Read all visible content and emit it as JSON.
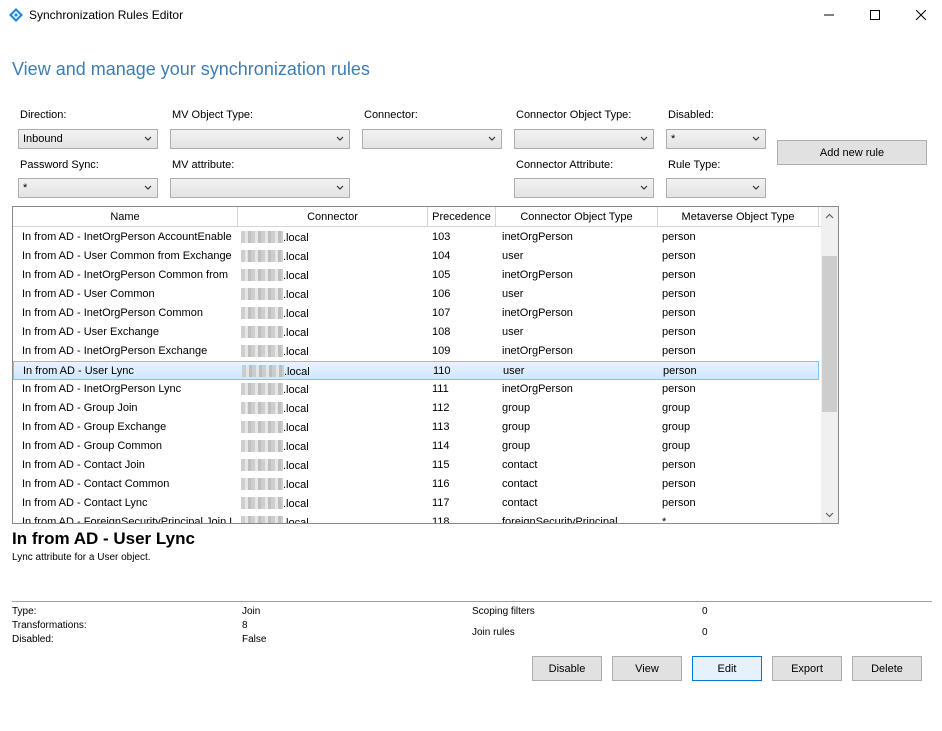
{
  "window": {
    "title": "Synchronization Rules Editor"
  },
  "heading": "View and manage your synchronization rules",
  "filters": {
    "direction": {
      "label": "Direction:",
      "value": "Inbound"
    },
    "mv_object_type": {
      "label": "MV Object Type:",
      "value": ""
    },
    "connector": {
      "label": "Connector:",
      "value": ""
    },
    "connector_object_type": {
      "label": "Connector Object Type:",
      "value": ""
    },
    "disabled": {
      "label": "Disabled:",
      "value": "*"
    },
    "password_sync": {
      "label": "Password Sync:",
      "value": "*"
    },
    "mv_attribute": {
      "label": "MV attribute:",
      "value": ""
    },
    "connector_attribute": {
      "label": "Connector Attribute:",
      "value": ""
    },
    "rule_type": {
      "label": "Rule Type:",
      "value": ""
    }
  },
  "add_rule_label": "Add new rule",
  "table": {
    "columns": [
      "Name",
      "Connector",
      "Precedence",
      "Connector Object Type",
      "Metaverse Object Type"
    ],
    "rows": [
      {
        "name": "In from AD - InetOrgPerson AccountEnabled",
        "connector": ".local",
        "precedence": "103",
        "cot": "inetOrgPerson",
        "mot": "person"
      },
      {
        "name": "In from AD - User Common from Exchange",
        "connector": ".local",
        "precedence": "104",
        "cot": "user",
        "mot": "person"
      },
      {
        "name": "In from AD - InetOrgPerson Common from Exchange",
        "connector": ".local",
        "precedence": "105",
        "cot": "inetOrgPerson",
        "mot": "person"
      },
      {
        "name": "In from AD - User Common",
        "connector": ".local",
        "precedence": "106",
        "cot": "user",
        "mot": "person"
      },
      {
        "name": "In from AD - InetOrgPerson Common",
        "connector": ".local",
        "precedence": "107",
        "cot": "inetOrgPerson",
        "mot": "person"
      },
      {
        "name": "In from AD - User Exchange",
        "connector": ".local",
        "precedence": "108",
        "cot": "user",
        "mot": "person"
      },
      {
        "name": "In from AD - InetOrgPerson Exchange",
        "connector": ".local",
        "precedence": "109",
        "cot": "inetOrgPerson",
        "mot": "person"
      },
      {
        "name": "In from AD - User Lync",
        "connector": ".local",
        "precedence": "110",
        "cot": "user",
        "mot": "person"
      },
      {
        "name": "In from AD - InetOrgPerson Lync",
        "connector": ".local",
        "precedence": "111",
        "cot": "inetOrgPerson",
        "mot": "person"
      },
      {
        "name": "In from AD - Group Join",
        "connector": ".local",
        "precedence": "112",
        "cot": "group",
        "mot": "group"
      },
      {
        "name": "In from AD - Group Exchange",
        "connector": ".local",
        "precedence": "113",
        "cot": "group",
        "mot": "group"
      },
      {
        "name": "In from AD - Group Common",
        "connector": ".local",
        "precedence": "114",
        "cot": "group",
        "mot": "group"
      },
      {
        "name": "In from AD - Contact Join",
        "connector": ".local",
        "precedence": "115",
        "cot": "contact",
        "mot": "person"
      },
      {
        "name": "In from AD - Contact Common",
        "connector": ".local",
        "precedence": "116",
        "cot": "contact",
        "mot": "person"
      },
      {
        "name": "In from AD - Contact Lync",
        "connector": ".local",
        "precedence": "117",
        "cot": "contact",
        "mot": "person"
      },
      {
        "name": "In from AD - ForeignSecurityPrincipal Join User",
        "connector": ".local",
        "precedence": "118",
        "cot": "foreignSecurityPrincipal",
        "mot": "*"
      }
    ]
  },
  "detail": {
    "title": "In from AD - User Lync",
    "description": "Lync attribute for a User object.",
    "type_label": "Type:",
    "type_value": "Join",
    "transformations_label": "Transformations:",
    "transformations_value": "8",
    "disabled_label": "Disabled:",
    "disabled_value": "False",
    "scoping_label": "Scoping filters",
    "scoping_value": "0",
    "join_label": "Join rules",
    "join_value": "0"
  },
  "actions": {
    "disable": "Disable",
    "view": "View",
    "edit": "Edit",
    "export": "Export",
    "delete": "Delete"
  }
}
